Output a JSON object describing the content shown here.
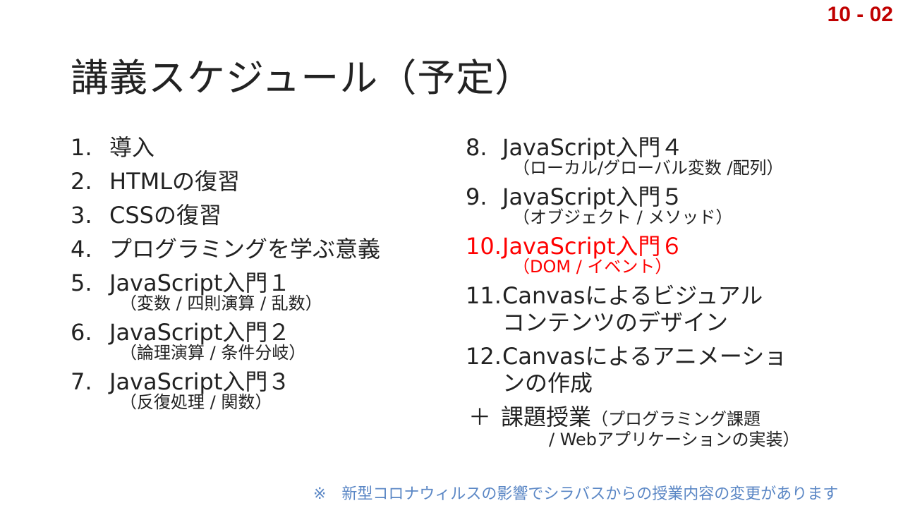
{
  "slide": {
    "number": "10 - 02",
    "title": "講義スケジュール（予定）",
    "accent_color": "#c00000",
    "highlight_color": "#ff0000",
    "note_color": "#5b87c5"
  },
  "schedule_left": [
    {
      "num": "1.",
      "label": "導入",
      "sub": ""
    },
    {
      "num": "2.",
      "label": "HTMLの復習",
      "sub": ""
    },
    {
      "num": "3.",
      "label": "CSSの復習",
      "sub": ""
    },
    {
      "num": "4.",
      "label": "プログラミングを学ぶ意義",
      "sub": ""
    },
    {
      "num": "5.",
      "label": "JavaScript入門１",
      "sub": "（変数 / 四則演算 / 乱数）"
    },
    {
      "num": "6.",
      "label": "JavaScript入門２",
      "sub": "（論理演算 / 条件分岐）"
    },
    {
      "num": "7.",
      "label": "JavaScript入門３",
      "sub": "（反復処理 / 関数）"
    }
  ],
  "schedule_right": [
    {
      "num": "8.",
      "label": "JavaScript入門４",
      "sub": "（ローカル/グローバル変数 /配列）"
    },
    {
      "num": "9.",
      "label": "JavaScript入門５",
      "sub": "（オブジェクト / メソッド）"
    },
    {
      "num": "10.",
      "label": "JavaScript入門６",
      "sub": "（DOM / イベント）"
    },
    {
      "num": "11.",
      "label": "Canvasによるビジュアル",
      "label2": "コンテンツのデザイン"
    },
    {
      "num": "12.",
      "label": "Canvasによるアニメーショ",
      "label2": "ンの作成"
    }
  ],
  "extra": {
    "symbol": "＋",
    "label": "課題授業",
    "sub_line1": "（プログラミング課題",
    "sub_line2": "/ Webアプリケーションの実装）"
  },
  "note": "※　新型コロナウィルスの影響でシラバスからの授業内容の変更があります"
}
